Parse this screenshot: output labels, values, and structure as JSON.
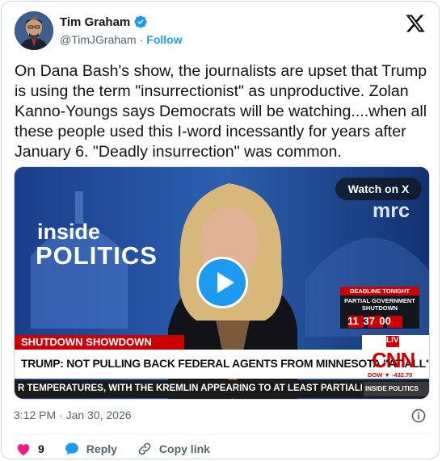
{
  "author": {
    "name": "Tim Graham",
    "handle": "@TimJGraham",
    "separator": "·",
    "follow_label": "Follow"
  },
  "tweet": {
    "text": "On Dana Bash's show, the journalists are upset that Trump is using the term \"insurrectionist\" as unproductive. Zolan Kanno-Youngs says Democrats will be watching....when all these people used this I-word incessantly for years after January 6. \"Deadly insurrection\" was common.",
    "timestamp": "3:12 PM · Jan 30, 2026"
  },
  "media": {
    "watch_label": "Watch on X",
    "show_line1": "inside",
    "show_line2": "POLITICS",
    "watermark": "mrc",
    "tag": "SHUTDOWN SHOWDOWN",
    "headline": "TRUMP: NOT PULLING BACK FEDERAL AGENTS FROM MINNESOTA \"AT ALL\"",
    "live": "LIVE",
    "network": "CNN",
    "deadline_label": "DEADLINE TONIGHT",
    "deadline_title": "PARTIAL GOVERNMENT SHUTDOWN",
    "clock": "11 37 00",
    "clock_units": "HRS  MIN  SEC",
    "dow": "DOW ▼ -432.70",
    "ticker": "R TEMPERATURES, WITH THE KREMLIN APPEARING TO AT LEAST PARTIALLY CONFIRM ",
    "ticker_tag": "INSIDE POLITICS"
  },
  "actions": {
    "likes": "9",
    "reply_label": "Reply",
    "copy_label": "Copy link"
  },
  "colors": {
    "accent": "#1d9bf0",
    "like": "#f91880",
    "cnn_red": "#cc0000"
  }
}
